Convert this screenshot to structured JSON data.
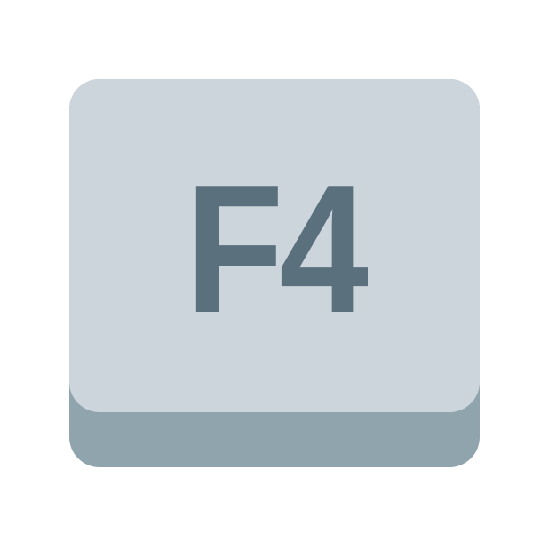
{
  "key": {
    "label": "F4",
    "top_color": "#ccd5dc",
    "base_color": "#8fa4ad",
    "label_color": "#5a707d"
  }
}
